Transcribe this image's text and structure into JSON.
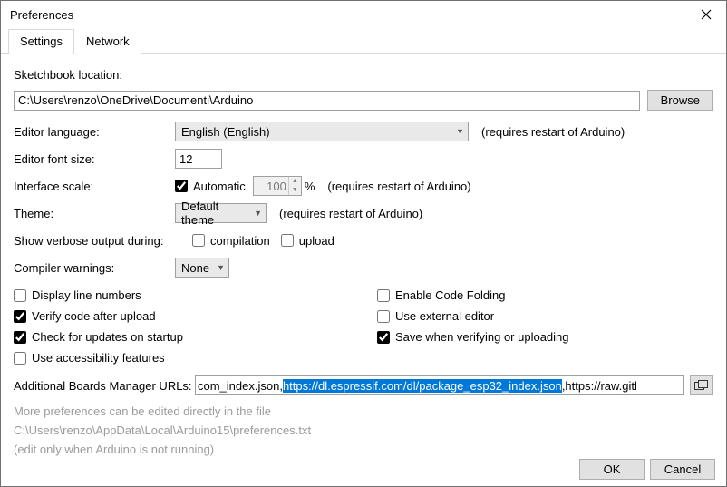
{
  "window": {
    "title": "Preferences"
  },
  "tabs": {
    "settings": "Settings",
    "network": "Network"
  },
  "labels": {
    "sketchbook_location": "Sketchbook location:",
    "editor_language": "Editor language:",
    "editor_font_size": "Editor font size:",
    "interface_scale": "Interface scale:",
    "theme": "Theme:",
    "verbose": "Show verbose output during:",
    "compiler_warnings": "Compiler warnings:",
    "additional_urls": "Additional Boards Manager URLs:",
    "restart_hint": "(requires restart of Arduino)"
  },
  "values": {
    "sketchbook_path": "C:\\Users\\renzo\\OneDrive\\Documenti\\Arduino",
    "language": "English (English)",
    "font_size": "12",
    "scale_auto": true,
    "scale_value": "100",
    "scale_pct": "%",
    "theme": "Default theme",
    "warnings": "None",
    "verbose_compilation": false,
    "verbose_upload": false,
    "url_pre": "com_index.json,",
    "url_sel": "https://dl.espressif.com/dl/package_esp32_index.json",
    "url_post": ",https://raw.gitl"
  },
  "checkboxes": {
    "automatic": "Automatic",
    "compilation": "compilation",
    "upload": "upload",
    "display_line_numbers": "Display line numbers",
    "enable_code_folding": "Enable Code Folding",
    "verify_after_upload": "Verify code after upload",
    "external_editor": "Use external editor",
    "check_updates": "Check for updates on startup",
    "save_on_verify": "Save when verifying or uploading",
    "accessibility": "Use accessibility features"
  },
  "check_state": {
    "display_line_numbers": false,
    "enable_code_folding": false,
    "verify_after_upload": true,
    "external_editor": false,
    "check_updates": true,
    "save_on_verify": true,
    "accessibility": false
  },
  "buttons": {
    "browse": "Browse",
    "ok": "OK",
    "cancel": "Cancel"
  },
  "more": {
    "line1": "More preferences can be edited directly in the file",
    "line2": "C:\\Users\\renzo\\AppData\\Local\\Arduino15\\preferences.txt",
    "line3": "(edit only when Arduino is not running)"
  }
}
